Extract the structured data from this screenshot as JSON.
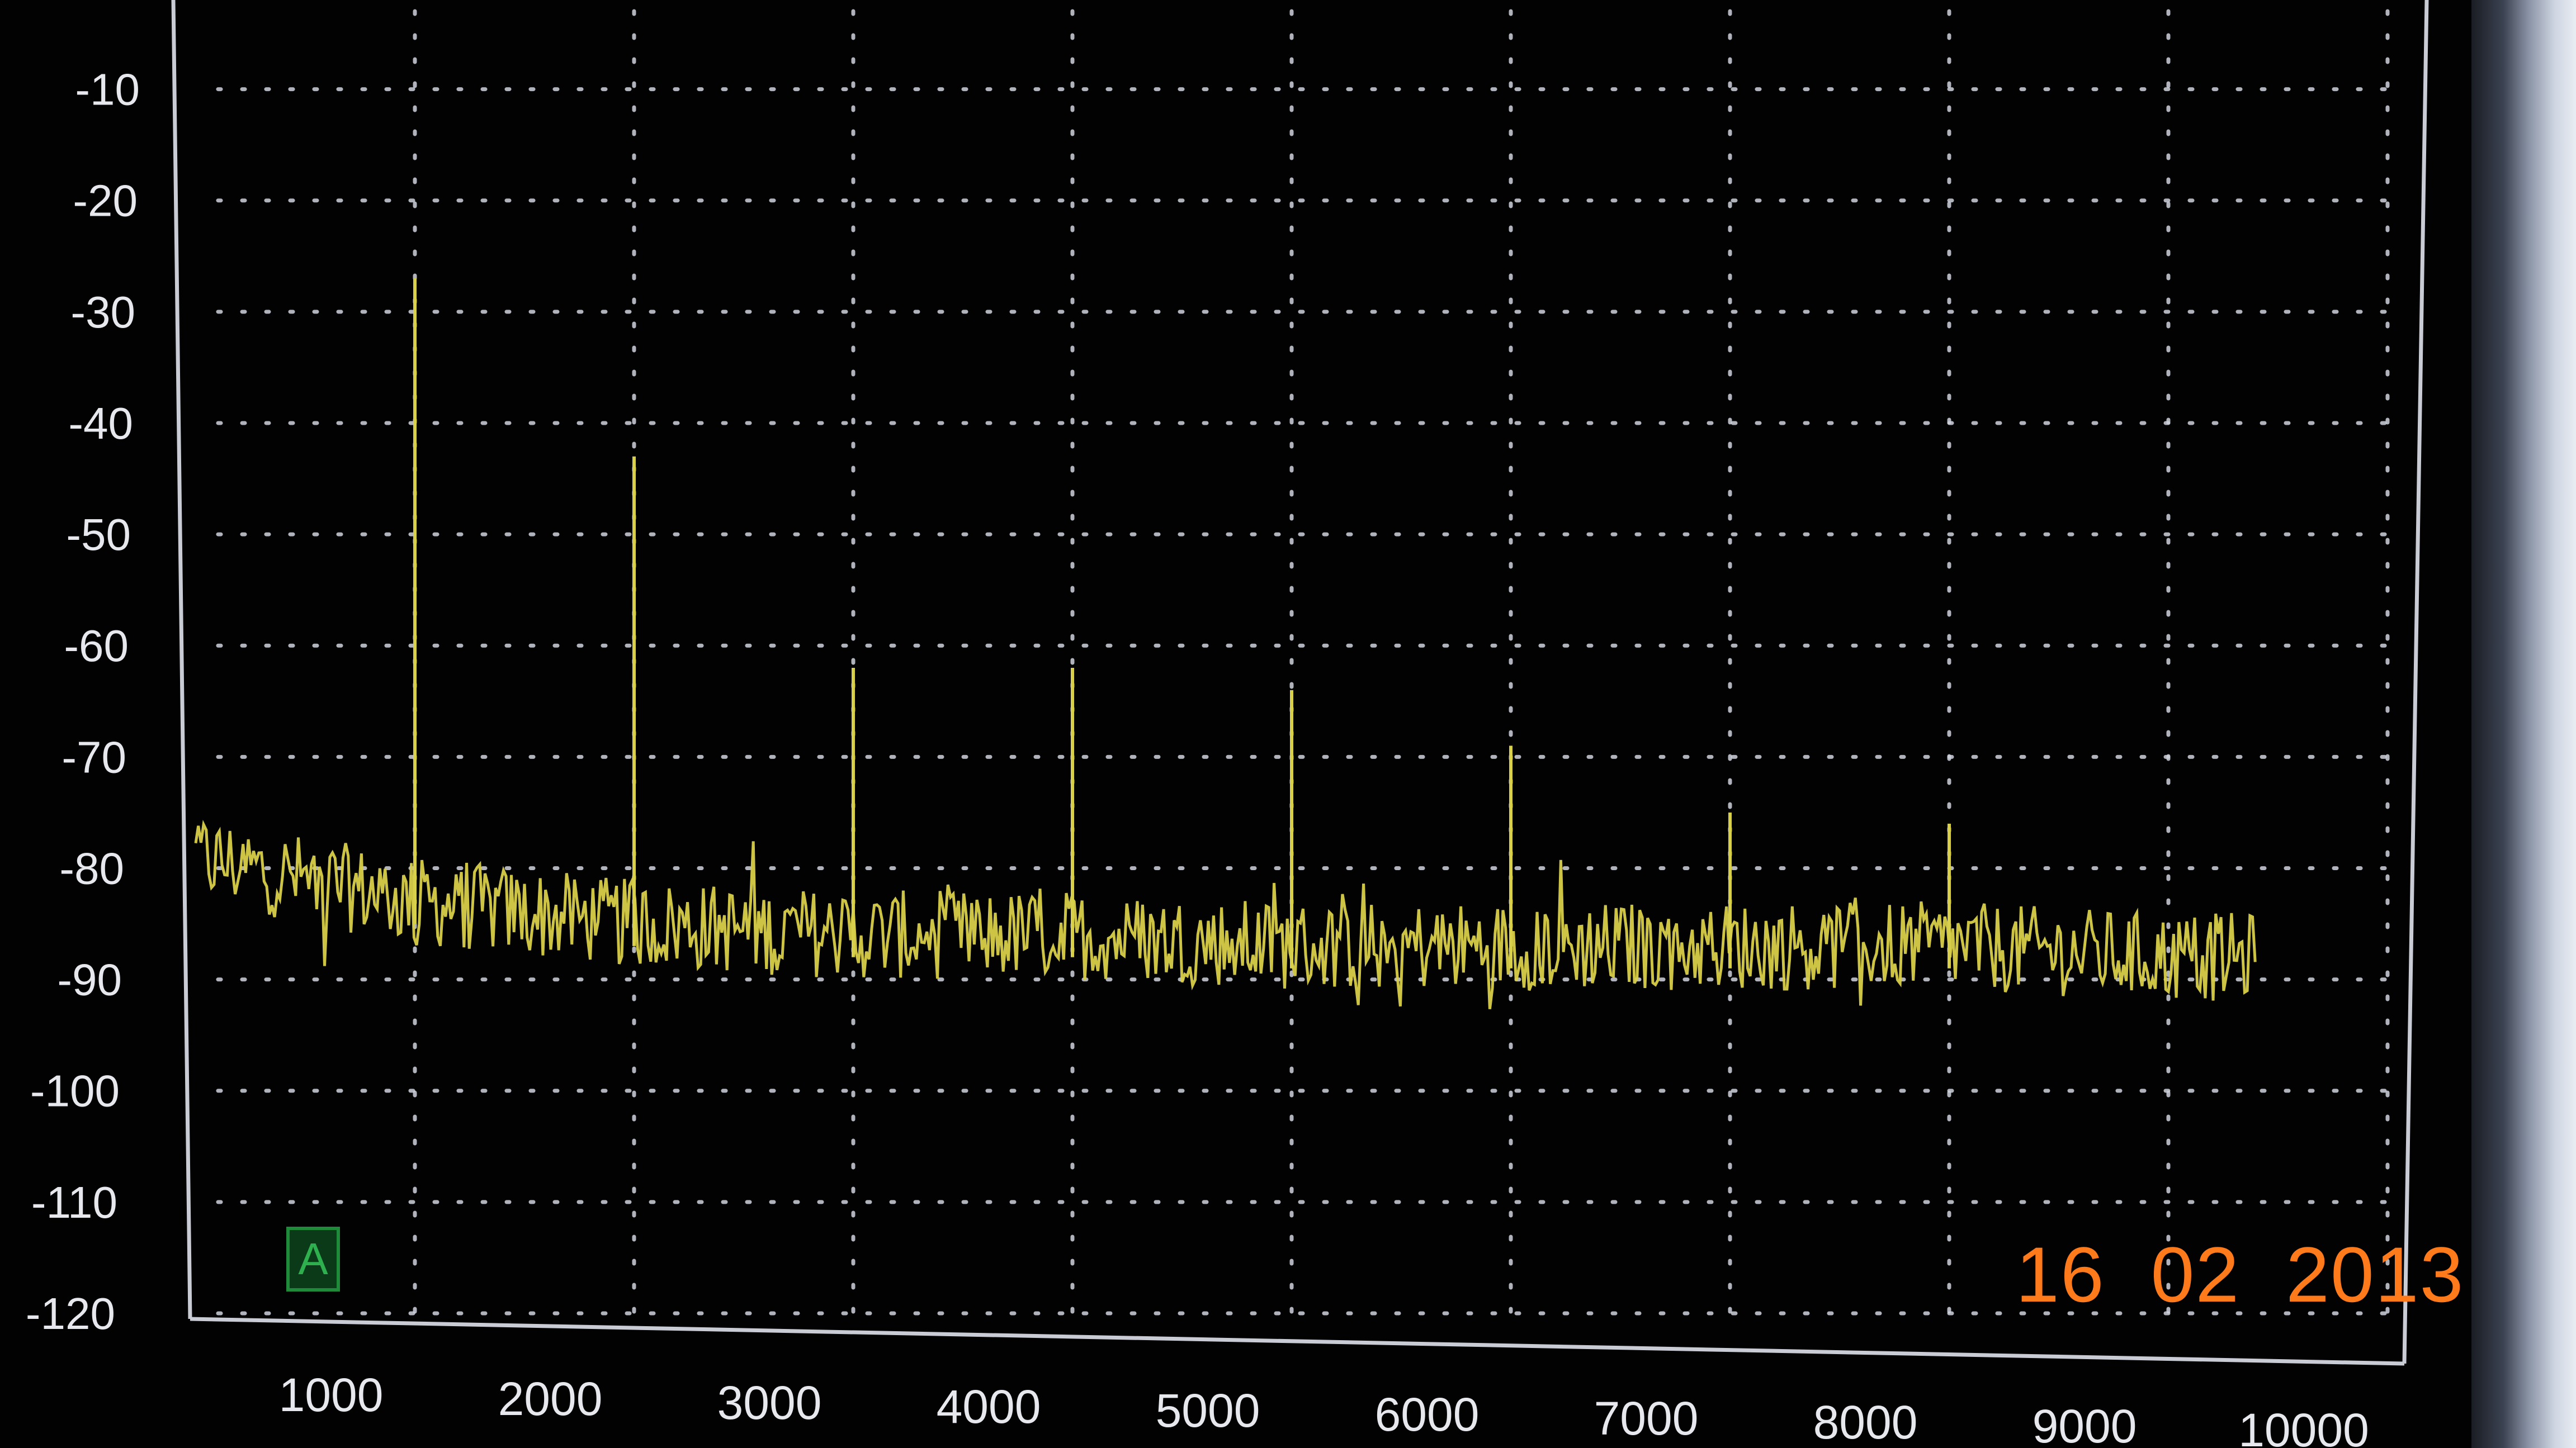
{
  "chart_data": {
    "type": "line",
    "title": "",
    "xlabel": "",
    "ylabel": "",
    "xlim": [
      0,
      10000
    ],
    "ylim": [
      -120,
      -5
    ],
    "x_ticks": [
      1000,
      2000,
      3000,
      4000,
      5000,
      6000,
      7000,
      8000,
      9000,
      10000
    ],
    "x_tick_labels": [
      "1000",
      "2000",
      "3000",
      "4000",
      "5000",
      "6000",
      "7000",
      "8000",
      "9000",
      "10000"
    ],
    "y_ticks": [
      -10,
      -20,
      -30,
      -40,
      -50,
      -60,
      -70,
      -80,
      -90,
      -100,
      -110,
      -120
    ],
    "y_tick_labels": [
      "-10",
      "-20",
      "-30",
      "-40",
      "-50",
      "-60",
      "-70",
      "-80",
      "-90",
      "-100",
      "-110",
      "-120"
    ],
    "grid": true,
    "series": [
      {
        "color": "#d8cf4a",
        "noise_floor": [
          [
            0,
            -79
          ],
          [
            500,
            -81
          ],
          [
            1000,
            -83
          ],
          [
            1500,
            -84
          ],
          [
            2000,
            -85
          ],
          [
            3000,
            -86
          ],
          [
            4000,
            -86
          ],
          [
            5000,
            -87
          ],
          [
            6000,
            -87
          ],
          [
            7000,
            -87
          ],
          [
            8000,
            -87
          ],
          [
            9000,
            -88
          ],
          [
            9400,
            -88
          ]
        ],
        "peaks": [
          [
            1000,
            -27
          ],
          [
            2000,
            -43
          ],
          [
            3000,
            -62
          ],
          [
            4000,
            -62
          ],
          [
            5000,
            -64
          ],
          [
            6000,
            -69
          ],
          [
            7000,
            -75
          ],
          [
            8000,
            -76
          ]
        ]
      }
    ]
  },
  "marker": {
    "label": "A",
    "color": "#1f8a3a"
  },
  "date_stamp": "16  02  2013",
  "colors": {
    "background": "#020203",
    "grid": "#cfd3dc",
    "trace": "#d8cf4a",
    "axis": "#c9ccd4",
    "stamp": "#ff7a1a"
  }
}
